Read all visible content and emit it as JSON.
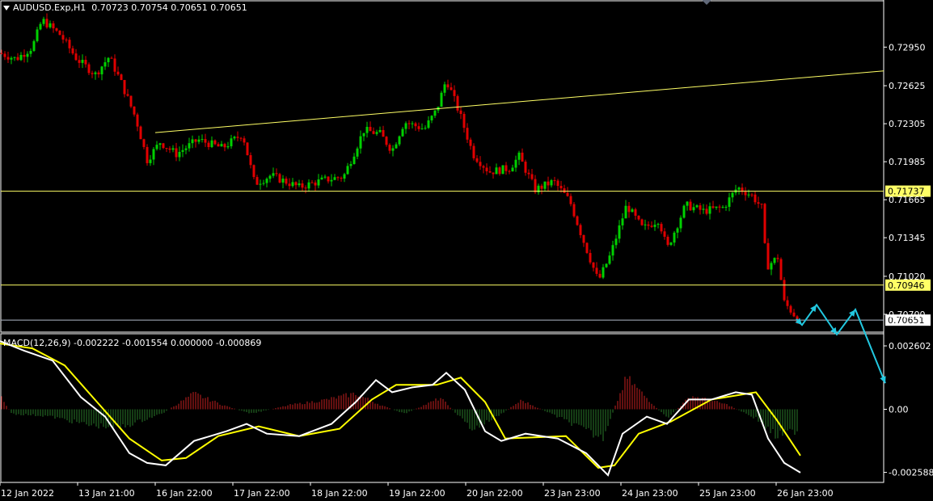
{
  "header": {
    "symbol": "AUDUSD.Exp,H1",
    "ohlc": "0.70723 0.70754 0.70651 0.70651",
    "macd": "MACD(12,26,9) -0.002222 -0.001554 0.000000 -0.000869"
  },
  "colors": {
    "background": "#000000",
    "bull": "#00d000",
    "bear": "#e00000",
    "trendline": "#ffff66",
    "level": "#ffff66",
    "last_price_line": "#b0b8c8",
    "axis": "#ffffff",
    "macd_main": "#ffffff",
    "macd_signal": "#ffff00",
    "hist_pos": "#c82020",
    "hist_neg": "#2a7a2a",
    "projection": "#22c8e0"
  },
  "chart_data": [
    {
      "type": "candlestick",
      "symbol": "AUDUSD.Exp",
      "timeframe": "H1",
      "y_ticks": [
        "0.72950",
        "0.72625",
        "0.72305",
        "0.71985",
        "0.71665",
        "0.71345",
        "0.71020",
        "0.70700"
      ],
      "ylim": [
        0.7055,
        0.7334
      ],
      "x_ticks": [
        "12 Jan 2022",
        "13 Jan 21:00",
        "16 Jan 22:00",
        "17 Jan 22:00",
        "18 Jan 22:00",
        "19 Jan 22:00",
        "20 Jan 22:00",
        "23 Jan 23:00",
        "24 Jan 23:00",
        "25 Jan 23:00",
        "26 Jan 23:00"
      ],
      "price_path": [
        {
          "t": 0,
          "p": 0.729
        },
        {
          "t": 20,
          "p": 0.7285
        },
        {
          "t": 40,
          "p": 0.7295
        },
        {
          "t": 52,
          "p": 0.7318
        },
        {
          "t": 75,
          "p": 0.7305
        },
        {
          "t": 95,
          "p": 0.7285
        },
        {
          "t": 118,
          "p": 0.7272
        },
        {
          "t": 135,
          "p": 0.7287
        },
        {
          "t": 150,
          "p": 0.7265
        },
        {
          "t": 168,
          "p": 0.7235
        },
        {
          "t": 182,
          "p": 0.72
        },
        {
          "t": 198,
          "p": 0.7215
        },
        {
          "t": 218,
          "p": 0.7205
        },
        {
          "t": 245,
          "p": 0.7217
        },
        {
          "t": 275,
          "p": 0.721
        },
        {
          "t": 300,
          "p": 0.7222
        },
        {
          "t": 315,
          "p": 0.718
        },
        {
          "t": 335,
          "p": 0.7187
        },
        {
          "t": 370,
          "p": 0.7177
        },
        {
          "t": 400,
          "p": 0.7183
        },
        {
          "t": 425,
          "p": 0.7186
        },
        {
          "t": 450,
          "p": 0.7225
        },
        {
          "t": 470,
          "p": 0.7222
        },
        {
          "t": 485,
          "p": 0.7208
        },
        {
          "t": 500,
          "p": 0.7232
        },
        {
          "t": 525,
          "p": 0.7226
        },
        {
          "t": 540,
          "p": 0.7242
        },
        {
          "t": 552,
          "p": 0.7268
        },
        {
          "t": 568,
          "p": 0.724
        },
        {
          "t": 585,
          "p": 0.7205
        },
        {
          "t": 605,
          "p": 0.719
        },
        {
          "t": 630,
          "p": 0.7193
        },
        {
          "t": 642,
          "p": 0.7203
        },
        {
          "t": 662,
          "p": 0.7175
        },
        {
          "t": 685,
          "p": 0.7182
        },
        {
          "t": 705,
          "p": 0.7165
        },
        {
          "t": 720,
          "p": 0.7135
        },
        {
          "t": 740,
          "p": 0.7098
        },
        {
          "t": 755,
          "p": 0.712
        },
        {
          "t": 775,
          "p": 0.7162
        },
        {
          "t": 795,
          "p": 0.7142
        },
        {
          "t": 815,
          "p": 0.715
        },
        {
          "t": 825,
          "p": 0.7125
        },
        {
          "t": 848,
          "p": 0.7162
        },
        {
          "t": 870,
          "p": 0.7157
        },
        {
          "t": 895,
          "p": 0.716
        },
        {
          "t": 912,
          "p": 0.7177
        },
        {
          "t": 930,
          "p": 0.717
        },
        {
          "t": 942,
          "p": 0.716
        },
        {
          "t": 948,
          "p": 0.711
        },
        {
          "t": 962,
          "p": 0.7118
        },
        {
          "t": 970,
          "p": 0.708
        },
        {
          "t": 988,
          "p": 0.7065
        }
      ],
      "trendline": {
        "from": {
          "t": 192,
          "p": 0.7223
        },
        "to": {
          "t": 1093,
          "p": 0.7275
        }
      },
      "levels": [
        {
          "value": 0.71737,
          "label": "0.71737"
        },
        {
          "value": 0.70946,
          "label": "0.70946"
        }
      ],
      "last_price": {
        "value": 0.70651,
        "label": "0.70651"
      },
      "projection": [
        {
          "t": 985,
          "p": 0.7066
        },
        {
          "t": 992,
          "p": 0.7061
        },
        {
          "t": 1010,
          "p": 0.7078
        },
        {
          "t": 1035,
          "p": 0.7053
        },
        {
          "t": 1058,
          "p": 0.7074
        },
        {
          "t": 1095,
          "p": 0.7012
        }
      ]
    },
    {
      "type": "macd",
      "title": "MACD(12,26,9)",
      "y_ticks": [
        "0.002602",
        "0.00",
        "-0.002588"
      ],
      "ylim": [
        -0.003,
        0.0031
      ],
      "main": [
        {
          "t": 0,
          "v": 0.0028
        },
        {
          "t": 30,
          "v": 0.0024
        },
        {
          "t": 65,
          "v": 0.002
        },
        {
          "t": 100,
          "v": 0.0005
        },
        {
          "t": 130,
          "v": -0.0003
        },
        {
          "t": 160,
          "v": -0.0018
        },
        {
          "t": 182,
          "v": -0.0022
        },
        {
          "t": 205,
          "v": -0.0023
        },
        {
          "t": 240,
          "v": -0.0013
        },
        {
          "t": 280,
          "v": -0.0009
        },
        {
          "t": 305,
          "v": -0.0006
        },
        {
          "t": 330,
          "v": -0.001
        },
        {
          "t": 370,
          "v": -0.0011
        },
        {
          "t": 410,
          "v": -0.0006
        },
        {
          "t": 440,
          "v": 0.0003
        },
        {
          "t": 465,
          "v": 0.0012
        },
        {
          "t": 485,
          "v": 0.0007
        },
        {
          "t": 510,
          "v": 0.0009
        },
        {
          "t": 535,
          "v": 0.001
        },
        {
          "t": 552,
          "v": 0.0015
        },
        {
          "t": 575,
          "v": 0.0008
        },
        {
          "t": 600,
          "v": -0.0009
        },
        {
          "t": 620,
          "v": -0.0013
        },
        {
          "t": 650,
          "v": -0.001
        },
        {
          "t": 690,
          "v": -0.0012
        },
        {
          "t": 725,
          "v": -0.0018
        },
        {
          "t": 752,
          "v": -0.0027
        },
        {
          "t": 770,
          "v": -0.001
        },
        {
          "t": 800,
          "v": -0.0003
        },
        {
          "t": 825,
          "v": -0.0006
        },
        {
          "t": 852,
          "v": 0.0004
        },
        {
          "t": 880,
          "v": 0.0004
        },
        {
          "t": 910,
          "v": 0.0007
        },
        {
          "t": 930,
          "v": 0.0006
        },
        {
          "t": 950,
          "v": -0.0012
        },
        {
          "t": 970,
          "v": -0.0022
        },
        {
          "t": 990,
          "v": -0.0026
        }
      ],
      "signal": [
        {
          "t": 0,
          "v": 0.0027
        },
        {
          "t": 40,
          "v": 0.0025
        },
        {
          "t": 80,
          "v": 0.0018
        },
        {
          "t": 120,
          "v": 0.0003
        },
        {
          "t": 160,
          "v": -0.0012
        },
        {
          "t": 200,
          "v": -0.0021
        },
        {
          "t": 230,
          "v": -0.002
        },
        {
          "t": 270,
          "v": -0.0011
        },
        {
          "t": 320,
          "v": -0.0007
        },
        {
          "t": 370,
          "v": -0.0011
        },
        {
          "t": 420,
          "v": -0.0008
        },
        {
          "t": 460,
          "v": 0.0004
        },
        {
          "t": 490,
          "v": 0.001
        },
        {
          "t": 540,
          "v": 0.001
        },
        {
          "t": 570,
          "v": 0.0013
        },
        {
          "t": 600,
          "v": 0.0003
        },
        {
          "t": 625,
          "v": -0.0012
        },
        {
          "t": 700,
          "v": -0.0011
        },
        {
          "t": 740,
          "v": -0.0024
        },
        {
          "t": 760,
          "v": -0.0023
        },
        {
          "t": 790,
          "v": -0.001
        },
        {
          "t": 830,
          "v": -0.0005
        },
        {
          "t": 880,
          "v": 0.0004
        },
        {
          "t": 935,
          "v": 0.0007
        },
        {
          "t": 960,
          "v": -0.0004
        },
        {
          "t": 990,
          "v": -0.0019
        }
      ],
      "histogram_envelope": [
        {
          "t": 0,
          "v": 0.0006
        },
        {
          "t": 15,
          "v": -0.0002
        },
        {
          "t": 60,
          "v": -0.0003
        },
        {
          "t": 110,
          "v": -0.0007
        },
        {
          "t": 150,
          "v": -0.0008
        },
        {
          "t": 200,
          "v": -0.0002
        },
        {
          "t": 240,
          "v": 0.0007
        },
        {
          "t": 275,
          "v": 0.0002
        },
        {
          "t": 310,
          "v": -0.0002
        },
        {
          "t": 360,
          "v": 0.0002
        },
        {
          "t": 400,
          "v": 0.0004
        },
        {
          "t": 440,
          "v": 0.0007
        },
        {
          "t": 470,
          "v": 0.0002
        },
        {
          "t": 500,
          "v": -0.0002
        },
        {
          "t": 545,
          "v": 0.0005
        },
        {
          "t": 585,
          "v": -0.0009
        },
        {
          "t": 620,
          "v": -0.0002
        },
        {
          "t": 645,
          "v": 0.0004
        },
        {
          "t": 700,
          "v": -0.0005
        },
        {
          "t": 745,
          "v": -0.0013
        },
        {
          "t": 775,
          "v": 0.0014
        },
        {
          "t": 800,
          "v": 0.0005
        },
        {
          "t": 825,
          "v": -0.0004
        },
        {
          "t": 855,
          "v": 0.0006
        },
        {
          "t": 900,
          "v": 0.0002
        },
        {
          "t": 935,
          "v": -0.0004
        },
        {
          "t": 960,
          "v": -0.0012
        },
        {
          "t": 988,
          "v": -0.0009
        }
      ]
    }
  ]
}
